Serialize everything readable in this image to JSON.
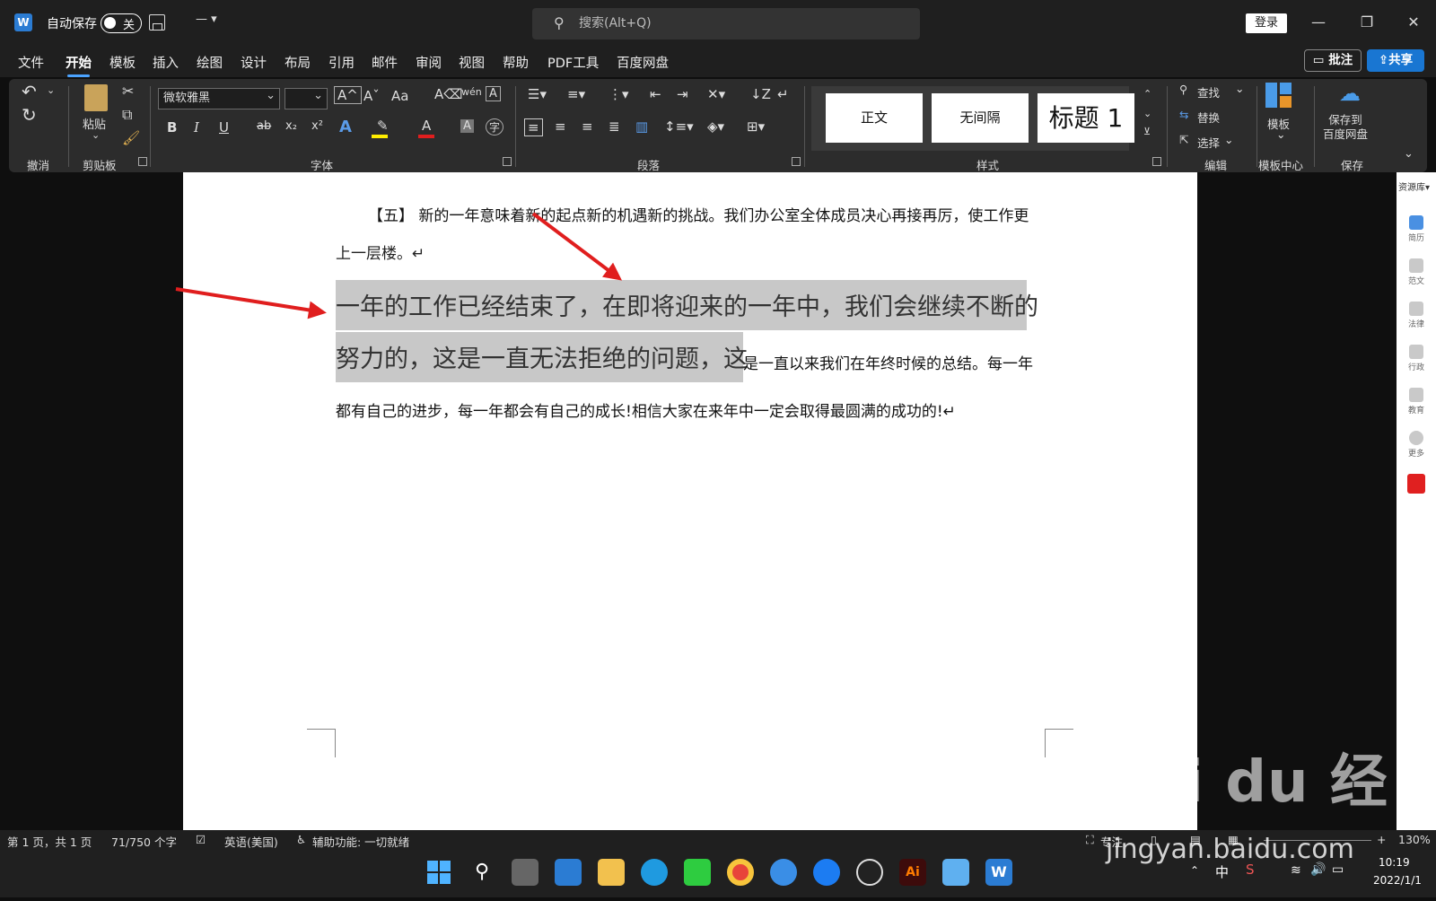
{
  "titlebar": {
    "autosave_label": "自动保存",
    "autosave_state": "关",
    "customize_label": "— ▾",
    "search_placeholder": "搜索(Alt+Q)",
    "login_label": "登录"
  },
  "menu": {
    "tabs": [
      "文件",
      "开始",
      "模板",
      "插入",
      "绘图",
      "设计",
      "布局",
      "引用",
      "邮件",
      "审阅",
      "视图",
      "帮助",
      "PDF工具",
      "百度网盘"
    ],
    "active_tab": "开始",
    "comment_label": "批注",
    "share_label": "共享"
  },
  "ribbon": {
    "groups": {
      "undo": "撤消",
      "clipboard": "剪贴板",
      "font": "字体",
      "paragraph": "段落",
      "styles": "样式",
      "editing": "编辑",
      "template_center": "模板中心",
      "save": "保存"
    },
    "paste_label": "粘贴",
    "font_name": "微软雅黑",
    "font_size": "",
    "case_label": "Aa",
    "styles": [
      "正文",
      "无间隔",
      "标题 1"
    ],
    "find_label": "查找",
    "replace_label": "替换",
    "select_label": "选择",
    "template_label": "模板",
    "save_to_baidu_label": "保存到\n百度网盘"
  },
  "document": {
    "para1_text": "【五】 新的一年意味着新的起点新的机遇新的挑战。我们办公室全体成员决心再接再厉，使工作更",
    "para1_cont": "上一层楼。↵",
    "hl_line1_a": "一年的工作已经结束了，",
    "hl_line1_b": "在即将迎来的一年中，",
    "hl_line1_c": "我们会继续不断的",
    "hl_line2_a": "努力的，",
    "hl_line2_b": "这是一直无法拒绝的问题，",
    "hl_line2_c": "这",
    "line2_rest": "是一直以来我们在年终时候的总结。每一年",
    "line3_text": "都有自己的进步，每一年都会有自己的成长!相信大家在来年中一定会取得最圆满的成功的!↵"
  },
  "sidepanel": {
    "header": "资源库▾",
    "items": [
      "简历",
      "范文",
      "法律",
      "行政",
      "教育",
      "更多"
    ]
  },
  "statusbar": {
    "page": "第 1 页，共 1 页",
    "word_count": "71/750 个字",
    "language": "英语(美国)",
    "accessibility": "辅助功能: 一切就绪",
    "focus": "专注",
    "zoom": "130%"
  },
  "taskbar": {
    "ime": "中",
    "time": "10:19",
    "date": "2022/1/1"
  },
  "watermark": {
    "logo_text": "Bai du 经验",
    "url": "jingyan.baidu.com"
  },
  "colors": {
    "accent": "#4ba3ff",
    "share": "#1976d2",
    "arrow": "#e01e1e",
    "highlight": "#c8c8c8"
  }
}
